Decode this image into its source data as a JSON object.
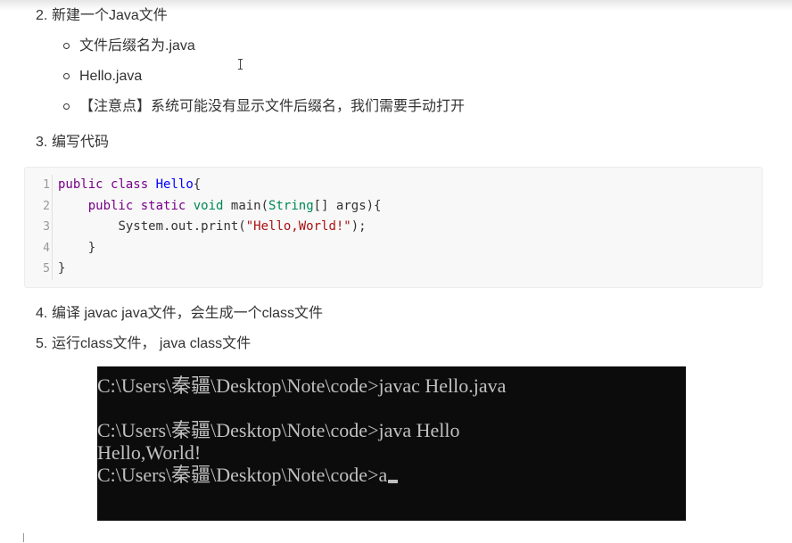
{
  "list": {
    "item2": {
      "number": "2.",
      "text": "新建一个Java文件"
    },
    "sub_items": [
      "文件后缀名为.java",
      "Hello.java",
      "【注意点】系统可能没有显示文件后缀名，我们需要手动打开"
    ],
    "item3": {
      "number": "3.",
      "text": "编写代码"
    },
    "item4": {
      "number": "4.",
      "text": "编译 javac  java文件，会生成一个class文件"
    },
    "item5": {
      "number": "5.",
      "text": "运行class文件， java class文件"
    }
  },
  "code_block": {
    "line_numbers": [
      "1",
      "2",
      "3",
      "4",
      "5"
    ],
    "lines": [
      {
        "indent": "",
        "tokens": [
          {
            "t": "public",
            "c": "kw"
          },
          {
            "t": " "
          },
          {
            "t": "class",
            "c": "kw"
          },
          {
            "t": " "
          },
          {
            "t": "Hello",
            "c": "cls"
          },
          {
            "t": "{"
          }
        ]
      },
      {
        "indent": "    ",
        "tokens": [
          {
            "t": "public",
            "c": "kw"
          },
          {
            "t": " "
          },
          {
            "t": "static",
            "c": "kw"
          },
          {
            "t": " "
          },
          {
            "t": "void",
            "c": "ty"
          },
          {
            "t": " main("
          },
          {
            "t": "String",
            "c": "ty"
          },
          {
            "t": "[] args){"
          }
        ]
      },
      {
        "indent": "        ",
        "tokens": [
          {
            "t": "System.out.print("
          },
          {
            "t": "\"Hello,World!\"",
            "c": "str"
          },
          {
            "t": ");"
          }
        ]
      },
      {
        "indent": "    ",
        "tokens": [
          {
            "t": "}"
          }
        ]
      },
      {
        "indent": "",
        "tokens": [
          {
            "t": "}"
          }
        ]
      }
    ]
  },
  "terminal": {
    "lines": [
      "C:\\Users\\秦疆\\Desktop\\Note\\code>javac Hello.java",
      "",
      "C:\\Users\\秦疆\\Desktop\\Note\\code>java Hello",
      "Hello,World!",
      "C:\\Users\\秦疆\\Desktop\\Note\\code>a"
    ]
  },
  "colors": {
    "keyword": "#770088",
    "type": "#008855",
    "class_name": "#0000ff",
    "string": "#aa1111",
    "terminal_bg": "#0c0c0c",
    "terminal_fg": "#c0c0c0"
  }
}
